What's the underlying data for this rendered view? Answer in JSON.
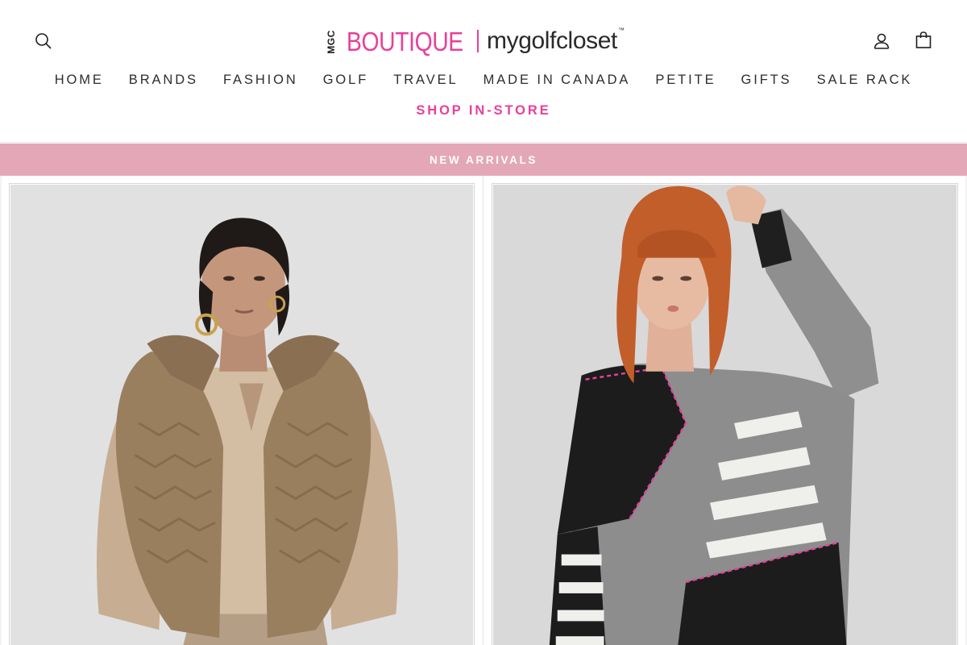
{
  "header": {
    "logo": {
      "mgc": "MGC",
      "boutique": "BOUTIQUE",
      "brand": "mygolfcloset",
      "tm": "™"
    },
    "icons": {
      "search": "search-icon",
      "account": "user-icon",
      "cart": "shopping-bag-icon"
    }
  },
  "nav": {
    "items": [
      {
        "label": "HOME"
      },
      {
        "label": "BRANDS"
      },
      {
        "label": "FASHION"
      },
      {
        "label": "GOLF"
      },
      {
        "label": "TRAVEL"
      },
      {
        "label": "MADE IN CANADA"
      },
      {
        "label": "PETITE"
      },
      {
        "label": "GIFTS"
      },
      {
        "label": "SALE RACK"
      }
    ],
    "highlight": {
      "label": "SHOP IN-STORE"
    }
  },
  "banner": {
    "label": "NEW ARRIVALS"
  },
  "colors": {
    "accent": "#e8409a",
    "banner": "#e4a7b7",
    "text": "#2d2d2d"
  }
}
